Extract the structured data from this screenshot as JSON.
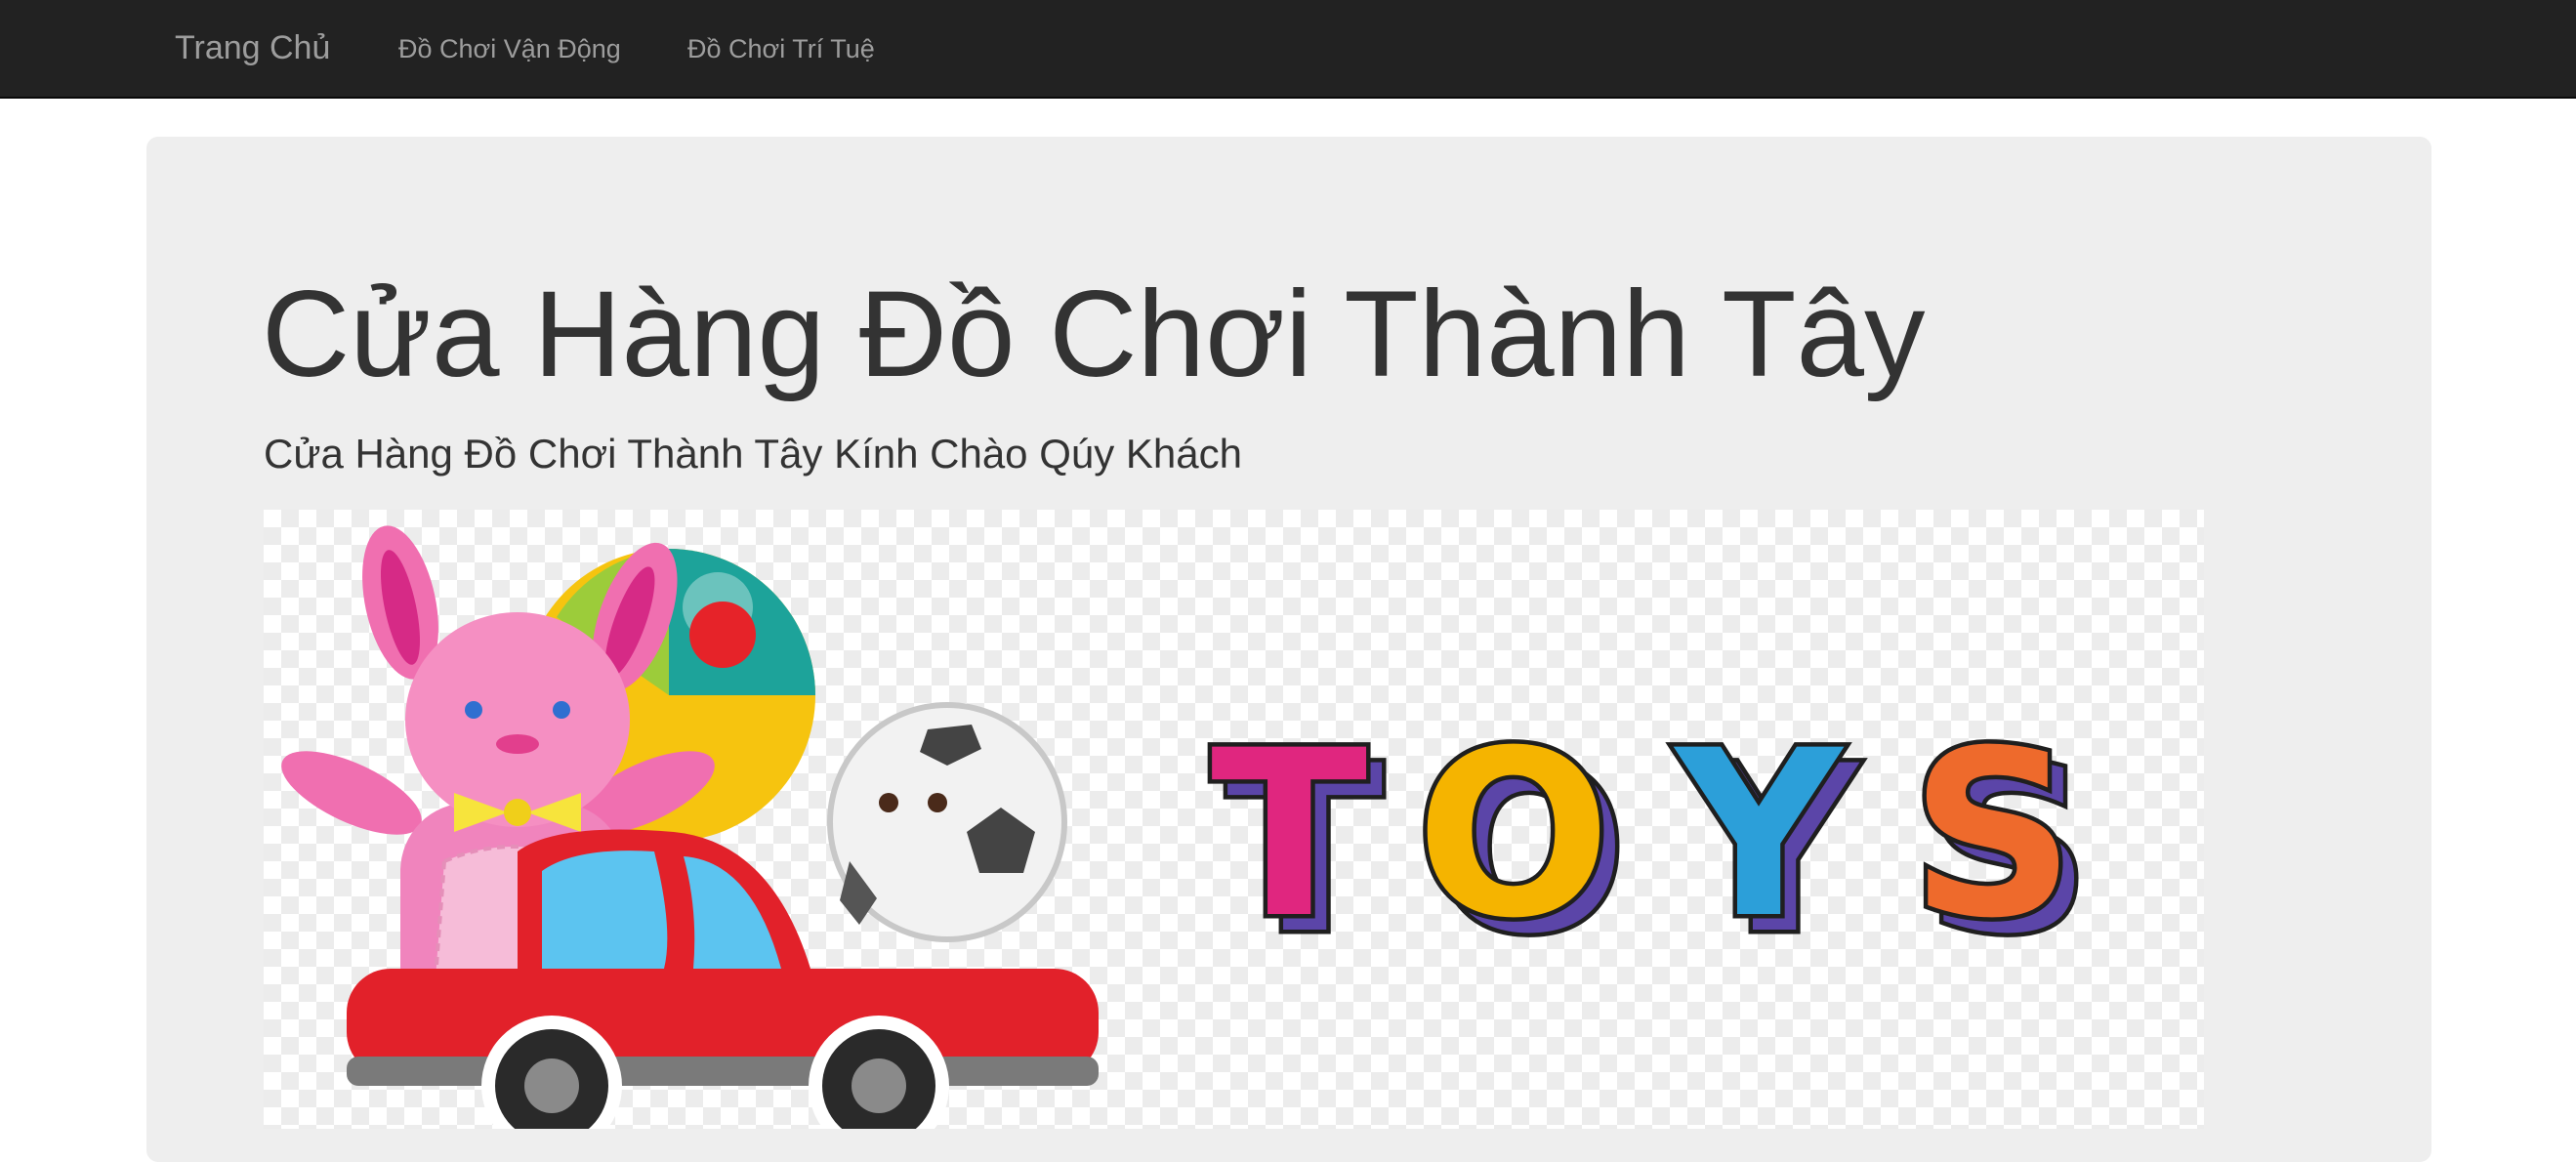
{
  "nav": {
    "brand": "Trang Chủ",
    "links": [
      "Đồ Chơi Vận Động",
      "Đồ Chơi Trí Tuệ"
    ]
  },
  "jumbotron": {
    "title": "Cửa Hàng Đồ Chơi Thành Tây",
    "subtitle": "Cửa Hàng Đồ Chơi Thành Tây Kính Chào Qúy Khách"
  },
  "hero": {
    "wordmark": "TOYS",
    "letter_colors": [
      "#e0267f",
      "#f5b400",
      "#2c9fd9",
      "#ee6a2c"
    ],
    "icons": [
      "bunny-icon",
      "beach-ball-icon",
      "soccer-ball-icon",
      "toy-car-icon"
    ]
  },
  "colors": {
    "navbar_bg": "#222222",
    "nav_text": "#9d9d9d",
    "jumbotron_bg": "#eeeeee",
    "text": "#333333"
  }
}
